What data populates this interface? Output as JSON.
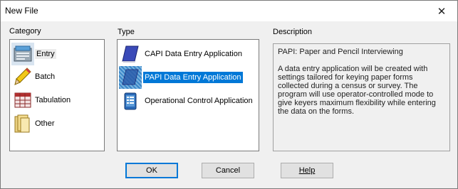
{
  "window": {
    "title": "New File",
    "close_glyph": "✕"
  },
  "category": {
    "label": "Category",
    "items": [
      {
        "label": "Entry",
        "icon": "entry-form-icon",
        "selected": true
      },
      {
        "label": "Batch",
        "icon": "pencil-icon",
        "selected": false
      },
      {
        "label": "Tabulation",
        "icon": "table-icon",
        "selected": false
      },
      {
        "label": "Other",
        "icon": "folder-icon",
        "selected": false
      }
    ]
  },
  "type": {
    "label": "Type",
    "items": [
      {
        "label": "CAPI Data Entry Application",
        "icon": "book-icon",
        "selected": false
      },
      {
        "label": "PAPI Data Entry Application",
        "icon": "book-icon",
        "selected": true
      },
      {
        "label": "Operational Control Application",
        "icon": "tablet-icon",
        "selected": false
      }
    ]
  },
  "description": {
    "label": "Description",
    "heading": "PAPI: Paper and Pencil Interviewing",
    "body": "A data entry application will be created with settings tailored for keying paper forms collected during a census or survey. The program will use operator-controlled mode to give keyers maximum flexibility while entering the data on the forms."
  },
  "buttons": {
    "ok": "OK",
    "cancel": "Cancel",
    "help": "Help"
  }
}
